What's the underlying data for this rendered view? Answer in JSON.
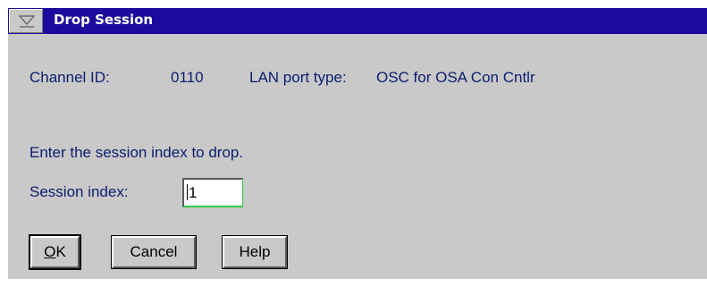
{
  "window": {
    "title": "Drop Session",
    "sysmenu_icon": "system-menu-icon"
  },
  "info": {
    "channel_label": "Channel ID:",
    "channel_value": "0110",
    "port_label": "LAN port type:",
    "port_value": "OSC for OSA Con Cntlr"
  },
  "form": {
    "instruction": "Enter the session index to drop.",
    "session_label": "Session index:",
    "session_value": "1"
  },
  "buttons": {
    "ok_mnemonic": "O",
    "ok_rest": "K",
    "cancel": "Cancel",
    "help": "Help"
  },
  "colors": {
    "titlebar": "#1c0a9c",
    "window_bg": "#c9c9c9",
    "label_text": "#0b1c6e"
  }
}
